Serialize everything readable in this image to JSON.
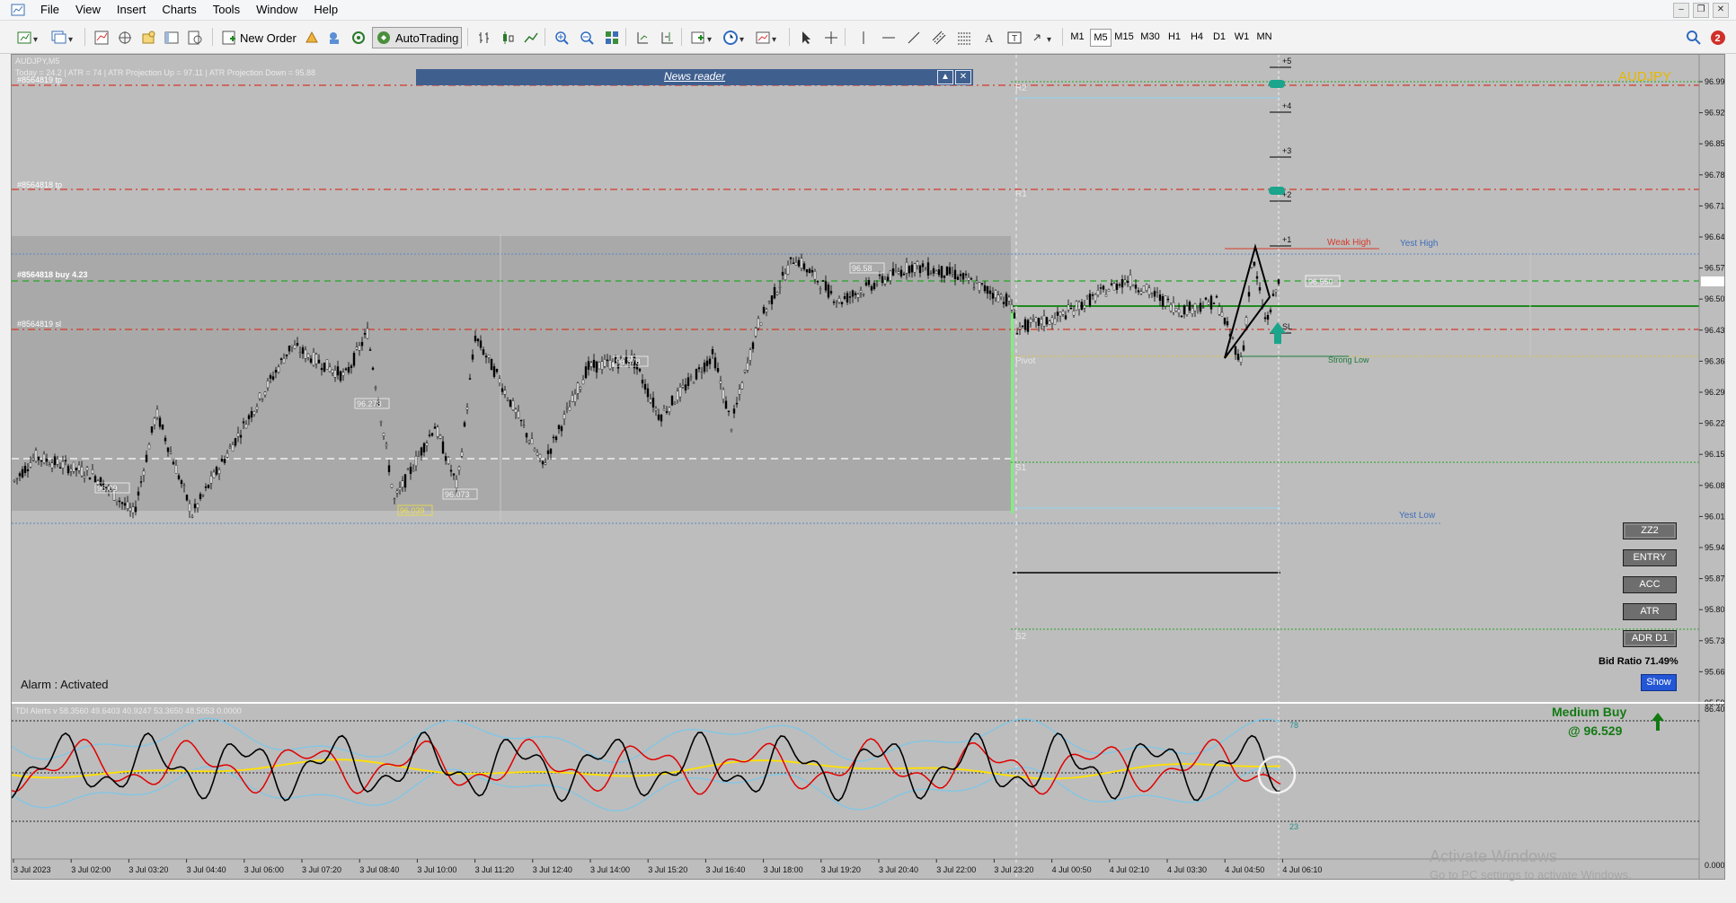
{
  "menu": [
    "File",
    "View",
    "Insert",
    "Charts",
    "Tools",
    "Window",
    "Help"
  ],
  "toolbar": {
    "new_order": "New Order",
    "autotrading": "AutoTrading",
    "timeframes": [
      "M1",
      "M5",
      "M15",
      "M30",
      "H1",
      "H4",
      "D1",
      "W1",
      "MN"
    ],
    "active_timeframe": "M5"
  },
  "chart": {
    "symbol": "AUDJPY,M5",
    "watermark_symbol": "AUDJPY",
    "info_line": "Today = 24.2   |   ATR = 74   |   ATR Projection Up = 97.11   |   ATR Projection Down = 95.88",
    "news_reader": "News reader",
    "alarm": "Alarm : Activated",
    "price_axis": [
      "96.995",
      "96.925",
      "96.855",
      "96.785",
      "96.715",
      "96.645",
      "96.575",
      "96.505",
      "96.435",
      "96.365",
      "96.295",
      "96.225",
      "96.155",
      "96.085",
      "96.015",
      "95.945",
      "95.875",
      "95.805",
      "95.735",
      "95.665",
      "95.595"
    ],
    "current_price": "96.550",
    "time_axis": [
      "3 Jul 2023",
      "3 Jul 02:00",
      "3 Jul 03:20",
      "3 Jul 04:40",
      "3 Jul 06:00",
      "3 Jul 07:20",
      "3 Jul 08:40",
      "3 Jul 10:00",
      "3 Jul 11:20",
      "3 Jul 12:40",
      "3 Jul 14:00",
      "3 Jul 15:20",
      "3 Jul 16:40",
      "3 Jul 18:00",
      "3 Jul 19:20",
      "3 Jul 20:40",
      "3 Jul 22:00",
      "3 Jul 23:20",
      "4 Jul 00:50",
      "4 Jul 02:10",
      "4 Jul 03:30",
      "4 Jul 04:50",
      "4 Jul 06:10"
    ],
    "order_labels": {
      "tp1": "#8564819 tp",
      "tp2": "#8564818 tp",
      "buy": "#8564818 buy 4.23",
      "sl": "#8564819 sl"
    },
    "levels": {
      "weak_high": "Weak High",
      "yest_high": "Yest High",
      "strong_low": "Strong Low",
      "yest_low": "Yest Low",
      "pivot": "Pivot",
      "r2": "R2",
      "r1": "R1",
      "s1": "S1",
      "s2": "S2"
    },
    "fractal_prices": [
      "96.09",
      "96.278",
      "96.039",
      "96.073",
      "96.378",
      "96.58"
    ],
    "ladder": [
      "+5",
      "+4",
      "+3",
      "+2",
      "+1",
      "SL"
    ],
    "buttons": [
      "ZZ2",
      "ENTRY",
      "ACC",
      "ATR",
      "ADR D1"
    ],
    "bid_ratio": "Bid Ratio 71.49%",
    "show": "Show",
    "signal_title": "Medium Buy",
    "signal_price": "@ 96.529"
  },
  "indicator": {
    "title": "TDI Alerts v 58.3560 49.6403 40.9247 53.3650 48.5053 0.0000",
    "level_78": "78",
    "level_23": "23",
    "axis_top": "86.4091",
    "axis_bottom": "0.0000"
  },
  "windows_notice": {
    "title": "Activate Windows",
    "subtitle": "Go to PC settings to activate Windows."
  },
  "colors": {
    "chart_bg": "#bdbdbd",
    "range_box": "#a9a9a9",
    "tp_line": "#d23a25",
    "buy_line": "#24a824",
    "tdi_red": "#e00000",
    "tdi_yellow": "#ffe000",
    "tdi_band": "#7fc6e6",
    "signal_green": "#1a7a1a",
    "watermark": "#e6b800"
  }
}
